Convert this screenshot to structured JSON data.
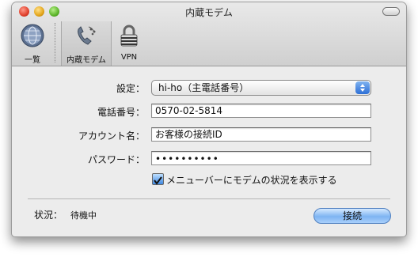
{
  "window": {
    "title": "内蔵モデム"
  },
  "toolbar": {
    "items": [
      {
        "label": "一覧",
        "icon": "globe-icon"
      },
      {
        "label": "内蔵モデム",
        "icon": "modem-phone-icon"
      },
      {
        "label": "VPN",
        "icon": "lock-icon"
      }
    ]
  },
  "form": {
    "config_label": "設定：",
    "config_value": "hi-ho（主電話番号）",
    "phone_label": "電話番号：",
    "phone_value": "0570-02-5814",
    "account_label": "アカウント名：",
    "account_value": "お客様の接続ID",
    "password_label": "パスワード：",
    "password_value": "••••••••••",
    "menubar_checkbox_label": "メニューバーにモデムの状況を表示する",
    "menubar_checkbox_checked": true
  },
  "status": {
    "label": "状況：",
    "value": "待機中"
  },
  "connect_button": "接続",
  "colors": {
    "accent": "#3d86e0",
    "button": "#7eb4f2"
  }
}
